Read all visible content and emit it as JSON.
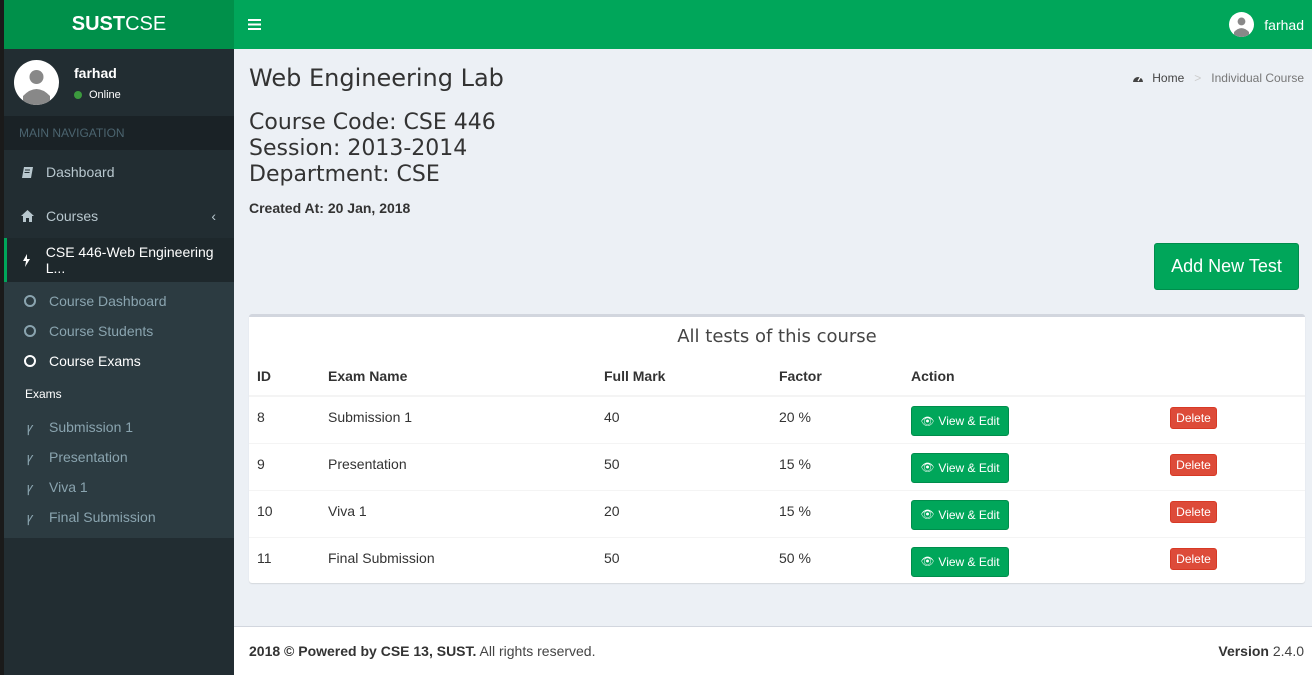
{
  "app": {
    "logo_bold": "SUST",
    "logo_rest": "CSE",
    "user_name": "farhad",
    "user_status": "Online"
  },
  "sidebar": {
    "header": "MAIN NAVIGATION",
    "items": [
      {
        "label": "Dashboard",
        "icon": "book-icon"
      },
      {
        "label": "Courses",
        "icon": "home-icon"
      },
      {
        "label": "CSE 446-Web Engineering L...",
        "icon": "bolt-icon"
      }
    ],
    "submenu": [
      {
        "label": "Course Dashboard"
      },
      {
        "label": "Course Students"
      },
      {
        "label": "Course Exams"
      }
    ],
    "exams_header": "Exams",
    "exams": [
      {
        "label": "Submission 1"
      },
      {
        "label": "Presentation"
      },
      {
        "label": "Viva 1"
      },
      {
        "label": "Final Submission"
      }
    ]
  },
  "topbar": {
    "user_name": "farhad"
  },
  "page": {
    "title": "Web Engineering Lab",
    "breadcrumb": {
      "home": "Home",
      "current": "Individual Course"
    },
    "course_code": "Course Code: CSE 446",
    "session": "Session: 2013-2014",
    "department": "Department: CSE",
    "created_label": "Created At: 20 Jan, 2018",
    "add_button": "Add New Test"
  },
  "tests": {
    "title": "All tests of this course",
    "columns": {
      "id": "ID",
      "name": "Exam Name",
      "full": "Full Mark",
      "factor": "Factor",
      "action": "Action"
    },
    "view_label": "View & Edit",
    "delete_label": "Delete",
    "rows": [
      {
        "id": "8",
        "name": "Submission 1",
        "full": "40",
        "factor": "20 %"
      },
      {
        "id": "9",
        "name": "Presentation",
        "full": "50",
        "factor": "15 %"
      },
      {
        "id": "10",
        "name": "Viva 1",
        "full": "20",
        "factor": "15 %"
      },
      {
        "id": "11",
        "name": "Final Submission",
        "full": "50",
        "factor": "50 %"
      }
    ]
  },
  "footer": {
    "bold": "2018 © Powered by CSE 13, SUST.",
    "rest": "All rights reserved.",
    "version_label": "Version",
    "version": "2.4.0"
  },
  "colors": {
    "brand": "#00a65a",
    "logo_bg": "#00904a",
    "sidebar_bg": "#222d32",
    "danger": "#dd4b39"
  }
}
